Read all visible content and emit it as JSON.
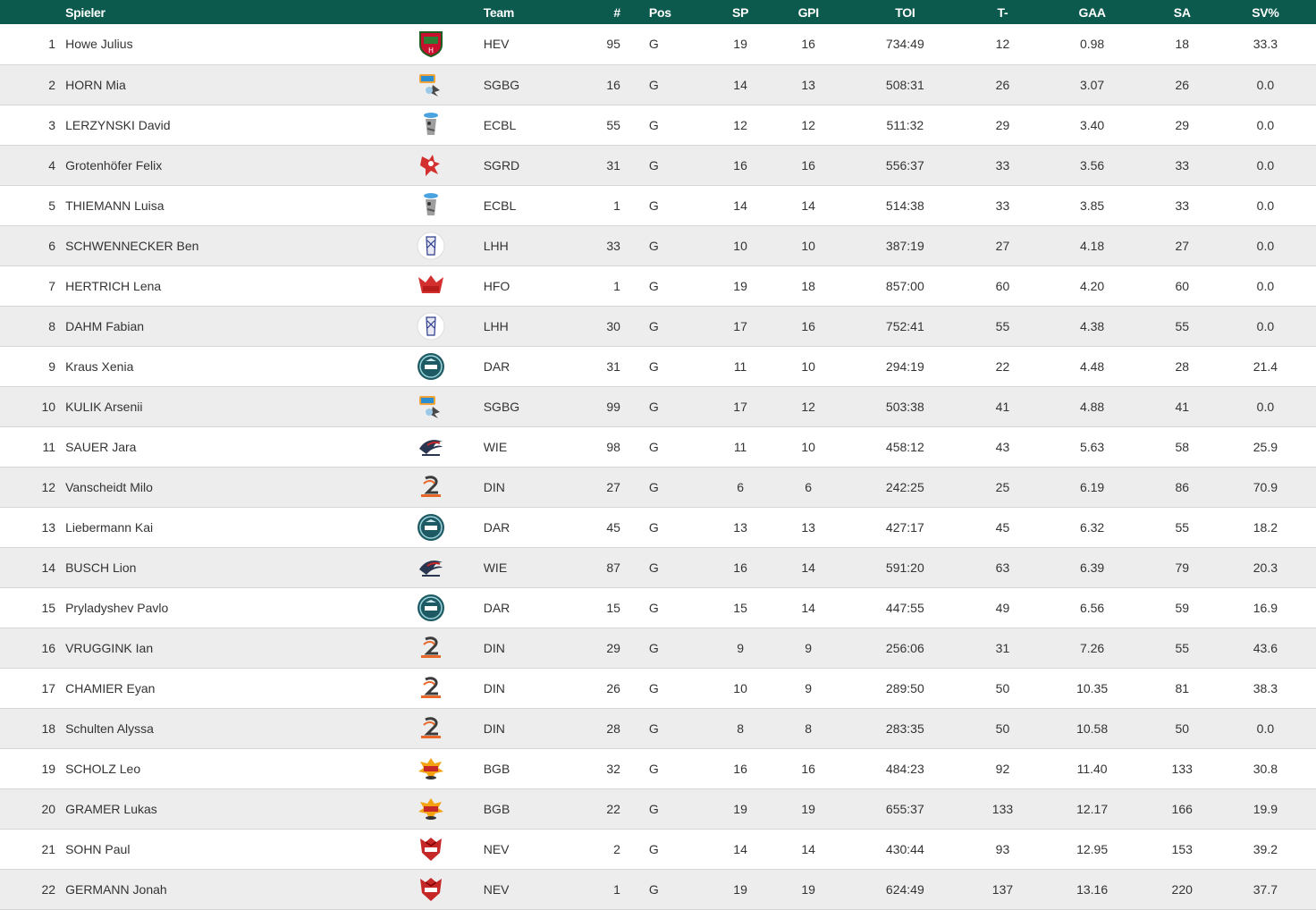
{
  "colors": {
    "header_bg": "#0c5a4d",
    "row_alt": "#ededed",
    "row_border": "#d6d6d6"
  },
  "headers": {
    "spieler": "Spieler",
    "team": "Team",
    "number": "#",
    "pos": "Pos",
    "sp": "SP",
    "gpi": "GPI",
    "toi": "TOI",
    "t_minus": "T-",
    "gaa": "GAA",
    "sa": "SA",
    "sv_pct": "SV%"
  },
  "rows": [
    {
      "rank": "1",
      "name": "Howe Julius",
      "logo": "hev-logo",
      "team": "HEV",
      "number": "95",
      "pos": "G",
      "sp": "19",
      "gpi": "16",
      "toi": "734:49",
      "t_minus": "12",
      "gaa": "0.98",
      "sa": "18",
      "sv_pct": "33.3"
    },
    {
      "rank": "2",
      "name": "HORN Mia",
      "logo": "sgbg-logo",
      "team": "SGBG",
      "number": "16",
      "pos": "G",
      "sp": "14",
      "gpi": "13",
      "toi": "508:31",
      "t_minus": "26",
      "gaa": "3.07",
      "sa": "26",
      "sv_pct": "0.0"
    },
    {
      "rank": "3",
      "name": "LERZYNSKI David",
      "logo": "ecbl-logo",
      "team": "ECBL",
      "number": "55",
      "pos": "G",
      "sp": "12",
      "gpi": "12",
      "toi": "511:32",
      "t_minus": "29",
      "gaa": "3.40",
      "sa": "29",
      "sv_pct": "0.0"
    },
    {
      "rank": "4",
      "name": "Grotenhöfer Felix",
      "logo": "sgrd-logo",
      "team": "SGRD",
      "number": "31",
      "pos": "G",
      "sp": "16",
      "gpi": "16",
      "toi": "556:37",
      "t_minus": "33",
      "gaa": "3.56",
      "sa": "33",
      "sv_pct": "0.0"
    },
    {
      "rank": "5",
      "name": "THIEMANN Luisa",
      "logo": "ecbl-logo",
      "team": "ECBL",
      "number": "1",
      "pos": "G",
      "sp": "14",
      "gpi": "14",
      "toi": "514:38",
      "t_minus": "33",
      "gaa": "3.85",
      "sa": "33",
      "sv_pct": "0.0"
    },
    {
      "rank": "6",
      "name": "SCHWENNECKER Ben",
      "logo": "lhh-logo",
      "team": "LHH",
      "number": "33",
      "pos": "G",
      "sp": "10",
      "gpi": "10",
      "toi": "387:19",
      "t_minus": "27",
      "gaa": "4.18",
      "sa": "27",
      "sv_pct": "0.0"
    },
    {
      "rank": "7",
      "name": "HERTRICH Lena",
      "logo": "hfo-logo",
      "team": "HFO",
      "number": "1",
      "pos": "G",
      "sp": "19",
      "gpi": "18",
      "toi": "857:00",
      "t_minus": "60",
      "gaa": "4.20",
      "sa": "60",
      "sv_pct": "0.0"
    },
    {
      "rank": "8",
      "name": "DAHM Fabian",
      "logo": "lhh-logo",
      "team": "LHH",
      "number": "30",
      "pos": "G",
      "sp": "17",
      "gpi": "16",
      "toi": "752:41",
      "t_minus": "55",
      "gaa": "4.38",
      "sa": "55",
      "sv_pct": "0.0"
    },
    {
      "rank": "9",
      "name": "Kraus Xenia",
      "logo": "dar-logo",
      "team": "DAR",
      "number": "31",
      "pos": "G",
      "sp": "11",
      "gpi": "10",
      "toi": "294:19",
      "t_minus": "22",
      "gaa": "4.48",
      "sa": "28",
      "sv_pct": "21.4"
    },
    {
      "rank": "10",
      "name": "KULIK Arsenii",
      "logo": "sgbg-logo",
      "team": "SGBG",
      "number": "99",
      "pos": "G",
      "sp": "17",
      "gpi": "12",
      "toi": "503:38",
      "t_minus": "41",
      "gaa": "4.88",
      "sa": "41",
      "sv_pct": "0.0"
    },
    {
      "rank": "11",
      "name": "SAUER Jara",
      "logo": "wie-logo",
      "team": "WIE",
      "number": "98",
      "pos": "G",
      "sp": "11",
      "gpi": "10",
      "toi": "458:12",
      "t_minus": "43",
      "gaa": "5.63",
      "sa": "58",
      "sv_pct": "25.9"
    },
    {
      "rank": "12",
      "name": "Vanscheidt Milo",
      "logo": "din-logo",
      "team": "DIN",
      "number": "27",
      "pos": "G",
      "sp": "6",
      "gpi": "6",
      "toi": "242:25",
      "t_minus": "25",
      "gaa": "6.19",
      "sa": "86",
      "sv_pct": "70.9"
    },
    {
      "rank": "13",
      "name": "Liebermann Kai",
      "logo": "dar-logo",
      "team": "DAR",
      "number": "45",
      "pos": "G",
      "sp": "13",
      "gpi": "13",
      "toi": "427:17",
      "t_minus": "45",
      "gaa": "6.32",
      "sa": "55",
      "sv_pct": "18.2"
    },
    {
      "rank": "14",
      "name": "BUSCH Lion",
      "logo": "wie-logo",
      "team": "WIE",
      "number": "87",
      "pos": "G",
      "sp": "16",
      "gpi": "14",
      "toi": "591:20",
      "t_minus": "63",
      "gaa": "6.39",
      "sa": "79",
      "sv_pct": "20.3"
    },
    {
      "rank": "15",
      "name": "Pryladyshev Pavlo",
      "logo": "dar-logo",
      "team": "DAR",
      "number": "15",
      "pos": "G",
      "sp": "15",
      "gpi": "14",
      "toi": "447:55",
      "t_minus": "49",
      "gaa": "6.56",
      "sa": "59",
      "sv_pct": "16.9"
    },
    {
      "rank": "16",
      "name": "VRUGGINK Ian",
      "logo": "din-logo",
      "team": "DIN",
      "number": "29",
      "pos": "G",
      "sp": "9",
      "gpi": "9",
      "toi": "256:06",
      "t_minus": "31",
      "gaa": "7.26",
      "sa": "55",
      "sv_pct": "43.6"
    },
    {
      "rank": "17",
      "name": "CHAMIER Eyan",
      "logo": "din-logo",
      "team": "DIN",
      "number": "26",
      "pos": "G",
      "sp": "10",
      "gpi": "9",
      "toi": "289:50",
      "t_minus": "50",
      "gaa": "10.35",
      "sa": "81",
      "sv_pct": "38.3"
    },
    {
      "rank": "18",
      "name": "Schulten Alyssa",
      "logo": "din-logo",
      "team": "DIN",
      "number": "28",
      "pos": "G",
      "sp": "8",
      "gpi": "8",
      "toi": "283:35",
      "t_minus": "50",
      "gaa": "10.58",
      "sa": "50",
      "sv_pct": "0.0"
    },
    {
      "rank": "19",
      "name": "SCHOLZ Leo",
      "logo": "bgb-logo",
      "team": "BGB",
      "number": "32",
      "pos": "G",
      "sp": "16",
      "gpi": "16",
      "toi": "484:23",
      "t_minus": "92",
      "gaa": "11.40",
      "sa": "133",
      "sv_pct": "30.8"
    },
    {
      "rank": "20",
      "name": "GRAMER Lukas",
      "logo": "bgb-logo",
      "team": "BGB",
      "number": "22",
      "pos": "G",
      "sp": "19",
      "gpi": "19",
      "toi": "655:37",
      "t_minus": "133",
      "gaa": "12.17",
      "sa": "166",
      "sv_pct": "19.9"
    },
    {
      "rank": "21",
      "name": "SOHN Paul",
      "logo": "nev-logo",
      "team": "NEV",
      "number": "2",
      "pos": "G",
      "sp": "14",
      "gpi": "14",
      "toi": "430:44",
      "t_minus": "93",
      "gaa": "12.95",
      "sa": "153",
      "sv_pct": "39.2"
    },
    {
      "rank": "22",
      "name": "GERMANN Jonah",
      "logo": "nev-logo",
      "team": "NEV",
      "number": "1",
      "pos": "G",
      "sp": "19",
      "gpi": "19",
      "toi": "624:49",
      "t_minus": "137",
      "gaa": "13.16",
      "sa": "220",
      "sv_pct": "37.7"
    }
  ]
}
